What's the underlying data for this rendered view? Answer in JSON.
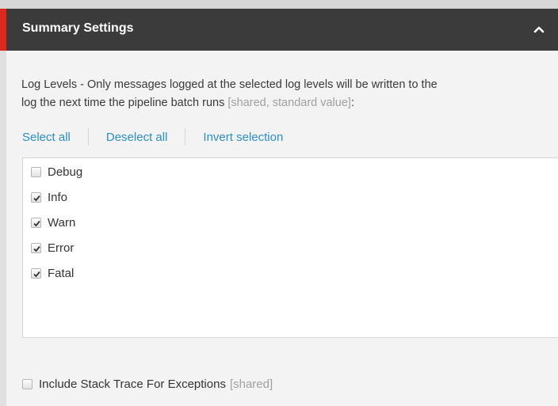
{
  "header": {
    "title": "Summary Settings",
    "collapse_icon": "chevron-up-icon"
  },
  "description": {
    "line1": "Log Levels - Only messages logged at the selected log levels will be written to the",
    "line2": "log the next time the pipeline batch runs",
    "hint": "[shared, standard value]",
    "colon": ":"
  },
  "actions": {
    "select_all": "Select all",
    "deselect_all": "Deselect all",
    "invert_selection": "Invert selection"
  },
  "options": [
    {
      "label": "Debug",
      "checked": false
    },
    {
      "label": "Info",
      "checked": true
    },
    {
      "label": "Warn",
      "checked": true
    },
    {
      "label": "Error",
      "checked": true
    },
    {
      "label": "Fatal",
      "checked": true
    }
  ],
  "stack_trace": {
    "label": "Include Stack Trace For Exceptions",
    "hint": "[shared]",
    "checked": false
  },
  "colors": {
    "accent": "#dc291e",
    "header_bg": "#3b3b3b",
    "link": "#2a8fcf"
  }
}
